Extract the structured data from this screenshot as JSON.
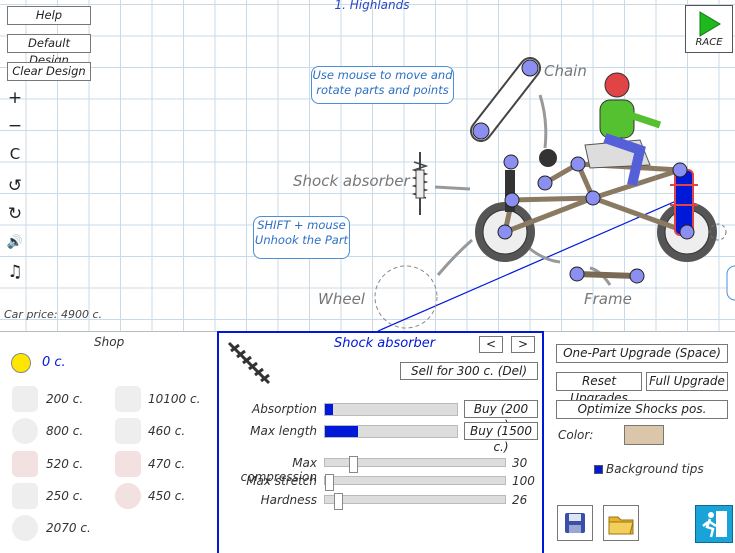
{
  "level_title": "1. Highlands",
  "left_menu": {
    "help": "Help",
    "default_design": "Default Design",
    "clear_design": "Clear Design"
  },
  "tools": [
    {
      "icon": "zoom-in-icon",
      "glyph": "+"
    },
    {
      "icon": "zoom-out-icon",
      "glyph": "−"
    },
    {
      "icon": "reset-view-icon",
      "glyph": "C"
    },
    {
      "icon": "undo-icon",
      "glyph": "↺"
    },
    {
      "icon": "redo-icon",
      "glyph": "↻"
    },
    {
      "icon": "sound-icon",
      "glyph": "🔊"
    },
    {
      "icon": "music-icon",
      "glyph": "♫"
    }
  ],
  "race_button": "RACE",
  "car_price": "Car price: 4900 c.",
  "hints": {
    "move": "Use mouse to move and rotate parts and points",
    "unhook": "SHIFT + mouse Unhook the Part"
  },
  "canvas_labels": {
    "chain": "Chain",
    "shock": "Shock absorber",
    "wheel": "Wheel",
    "frame": "Frame"
  },
  "shop": {
    "title": "Shop",
    "money": "0 c.",
    "items": [
      {
        "icon": "frame-bar-icon",
        "price": "200 c."
      },
      {
        "icon": "engine-icon",
        "price": "10100 c."
      },
      {
        "icon": "wheel-icon",
        "price": "800 c."
      },
      {
        "icon": "frame-joint-icon",
        "price": "460 c."
      },
      {
        "icon": "spring-icon",
        "price": "520 c."
      },
      {
        "icon": "hammer-icon",
        "price": "470 c."
      },
      {
        "icon": "chain-icon",
        "price": "250 c."
      },
      {
        "icon": "gear-icon",
        "price": "450 c."
      },
      {
        "icon": "tire-icon",
        "price": "2070 c."
      }
    ]
  },
  "part": {
    "name": "Shock absorber",
    "prev": "<",
    "next": ">",
    "sell": "Sell for  300 c. (Del)",
    "upgrades": [
      {
        "label": "Absorption",
        "level": 0.06,
        "buy": "Buy (200 c.)"
      },
      {
        "label": "Max length",
        "level": 0.25,
        "buy": "Buy (1500 c.)"
      }
    ],
    "sliders": [
      {
        "label": "Max compression",
        "value": "30",
        "level": 0.14
      },
      {
        "label": "Max stretch",
        "value": "100",
        "level": 0.0
      },
      {
        "label": "Hardness",
        "value": "26",
        "level": 0.05
      }
    ]
  },
  "right": {
    "one_part": "One-Part Upgrade (Space)",
    "reset_upgrades": "Reset Upgrades",
    "full_upgrade": "Full Upgrade",
    "optimize": "Optimize Shocks pos.",
    "color_label": "Color:",
    "color": "#dcc6aa",
    "background_tips": "Background tips"
  },
  "colors": {
    "accent": "#0018d8",
    "hint_blue": "#2d6fc4",
    "race_green": "#1fb81f"
  }
}
